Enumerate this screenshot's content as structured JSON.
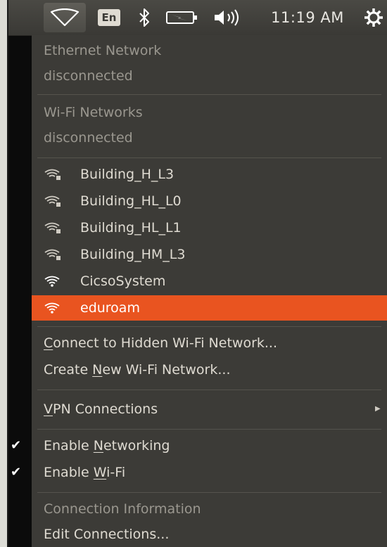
{
  "panel": {
    "keyboard_layout": "En",
    "clock": "11:19 AM",
    "icons": [
      "network-wifi-icon",
      "keyboard-layout-indicator",
      "bluetooth-icon",
      "battery-icon",
      "volume-icon",
      "session-gear-icon"
    ]
  },
  "menu": {
    "ethernet": {
      "title": "Ethernet Network",
      "status": "disconnected"
    },
    "wifi": {
      "title": "Wi-Fi Networks",
      "status": "disconnected"
    },
    "networks": [
      {
        "name": "Building_H_L3",
        "icon": "wifi-signal-icon"
      },
      {
        "name": "Building_HL_L0",
        "icon": "wifi-signal-icon"
      },
      {
        "name": "Building_HL_L1",
        "icon": "wifi-signal-icon"
      },
      {
        "name": "Building_HM_L3",
        "icon": "wifi-signal-icon"
      },
      {
        "name": "CicsoSystem",
        "icon": "wifi-signal-icon"
      },
      {
        "name": "eduroam",
        "icon": "wifi-signal-icon",
        "highlighted": true
      }
    ],
    "hidden_wifi": {
      "pre": "",
      "mnemonic": "C",
      "post": "onnect to Hidden Wi-Fi Network..."
    },
    "new_wifi": {
      "pre": "Create ",
      "mnemonic": "N",
      "post": "ew Wi-Fi Network..."
    },
    "vpn": {
      "pre": "",
      "mnemonic": "V",
      "post": "PN Connections"
    },
    "enable_networking": {
      "pre": "Enable ",
      "mnemonic": "N",
      "post": "etworking",
      "checked": true
    },
    "enable_wifi": {
      "pre": "Enable ",
      "mnemonic": "W",
      "post": "i-Fi",
      "checked": true
    },
    "connection_info": "Connection Information",
    "edit_connections": "Edit Connections..."
  },
  "colors": {
    "highlight": "#e95420",
    "menu_bg": "#3c3b37",
    "text": "#dfdbd2",
    "dim_text": "#9a978f"
  }
}
